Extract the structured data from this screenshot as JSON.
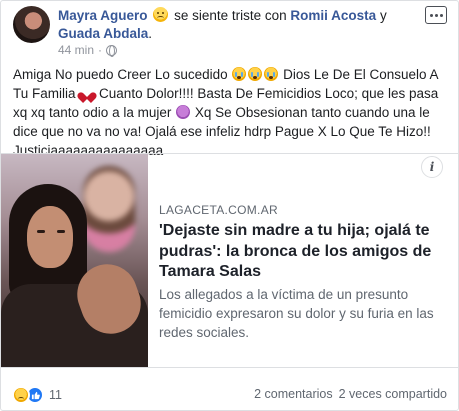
{
  "post": {
    "author": "Mayra Aguero",
    "feeling_text": "se siente triste con",
    "tagged_1": "Romii Acosta",
    "conjunction": "y",
    "tagged_2": "Guada Abdala",
    "time": "44 min",
    "separator": "·",
    "text_1": "Amiga No puedo Creer Lo sucedido",
    "text_2": "Dios Le De El Consuelo A Tu Familia",
    "text_3": "Cuanto Dolor!!!! Basta De Femicidios Loco; que les pasa xq xq tanto odio a la mujer",
    "text_4": "Xq Se Obsesionan tanto cuando una le dice que no va no va! Ojalá ese infeliz hdrp Pague X Lo Que Te Hizo!! Justiciaaaaaaaaaaaaaaa"
  },
  "link": {
    "domain": "LAGACETA.COM.AR",
    "title": "'Dejaste sin madre a tu hija; ojalá te pudras': la bronca de los amigos de Tamara Salas",
    "description": "Los allegados a la víctima de un presunto femicidio expresaron su dolor y su furia en las redes sociales.",
    "info_glyph": "i"
  },
  "footer": {
    "reaction_count": "11",
    "comments": "2 comentarios",
    "shares": "2 veces compartido"
  },
  "icons": {
    "more": "more-options-icon",
    "globe": "globe-icon",
    "info": "info-icon",
    "sad": "sad-reaction-icon",
    "like": "like-reaction-icon"
  },
  "colors": {
    "link_blue": "#385898",
    "like_blue": "#2078f4",
    "secondary_text": "#606770",
    "border": "#dddfe2"
  }
}
